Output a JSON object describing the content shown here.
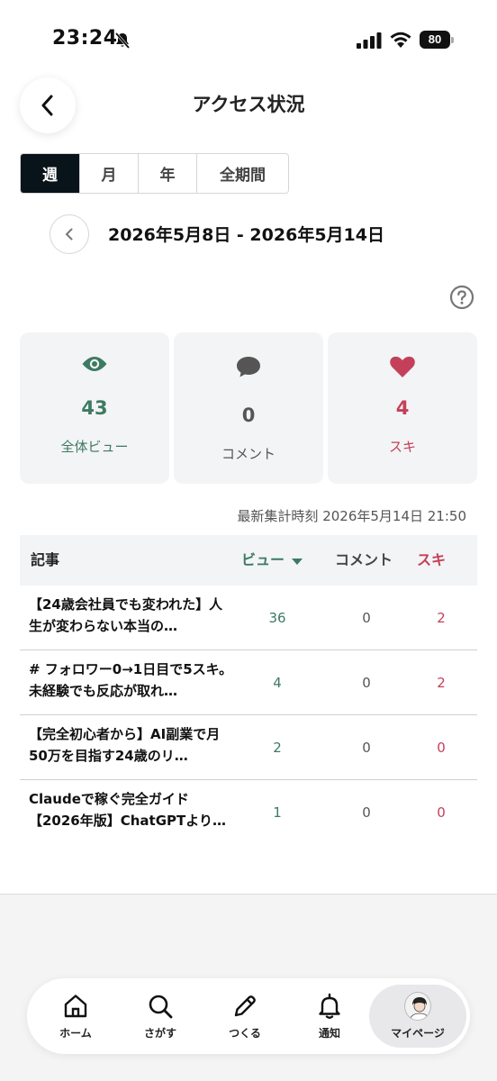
{
  "status_bar": {
    "time": "23:24",
    "battery": "80"
  },
  "header": {
    "title": "アクセス状況"
  },
  "period_tabs": [
    {
      "label": "週",
      "active": true
    },
    {
      "label": "月",
      "active": false
    },
    {
      "label": "年",
      "active": false
    },
    {
      "label": "全期間",
      "active": false
    }
  ],
  "date_range": "2026年5月8日 - 2026年5月14日",
  "stats": {
    "views": {
      "value": "43",
      "label": "全体ビュー"
    },
    "comments": {
      "value": "0",
      "label": "コメント"
    },
    "likes": {
      "value": "4",
      "label": "スキ"
    }
  },
  "updated_at": "最新集計時刻 2026年5月14日 21:50",
  "table": {
    "headers": {
      "article": "記事",
      "views": "ビュー",
      "comments": "コメント",
      "likes": "スキ"
    },
    "rows": [
      {
        "title": "【24歳会社員でも変われた】人生が変わらない本当の…",
        "views": "36",
        "comments": "0",
        "likes": "2"
      },
      {
        "title": "# フォロワー0→1日目で5スキ。未経験でも反応が取れ…",
        "views": "4",
        "comments": "0",
        "likes": "2"
      },
      {
        "title": "【完全初心者から】AI副業で月50万を目指す24歳のリ…",
        "views": "2",
        "comments": "0",
        "likes": "0"
      },
      {
        "title": "Claudeで稼ぐ完全ガイド【2026年版】ChatGPTより…",
        "views": "1",
        "comments": "0",
        "likes": "0"
      }
    ]
  },
  "bottom_nav": [
    {
      "label": "ホーム",
      "icon": "home-icon"
    },
    {
      "label": "さがす",
      "icon": "search-icon"
    },
    {
      "label": "つくる",
      "icon": "pencil-icon"
    },
    {
      "label": "通知",
      "icon": "bell-icon"
    },
    {
      "label": "マイページ",
      "icon": "avatar-icon",
      "active": true
    }
  ],
  "colors": {
    "accent_green": "#3d7a62",
    "accent_pink": "#c4405a",
    "tab_active": "#08131a"
  }
}
